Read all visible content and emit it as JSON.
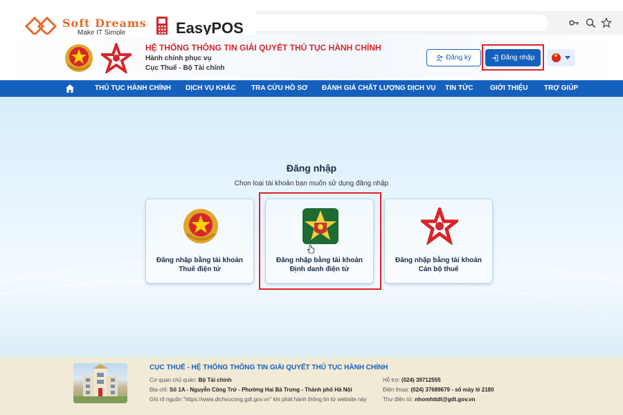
{
  "watermarks": {
    "softdreams": {
      "name": "Soft Dreams",
      "tagline": "Make IT Simple"
    },
    "easypos": {
      "name": "EasyPOS"
    }
  },
  "browser": {
    "icons": [
      "site-settings-icon",
      "key-icon",
      "zoom-icon",
      "star-icon"
    ]
  },
  "header": {
    "title": "HỆ THỐNG THÔNG TIN GIẢI QUYẾT THỦ TỤC HÀNH CHÍNH",
    "subtitle": "Hành chính phục vụ",
    "agency": "Cục Thuế - Bộ Tài chính",
    "register_label": "Đăng ký",
    "login_label": "Đăng nhập"
  },
  "nav": {
    "items": [
      {
        "label": "THỦ TỤC HÀNH CHÍNH"
      },
      {
        "label": "DỊCH VỤ KHÁC"
      },
      {
        "label": "TRA CỨU HỒ SƠ"
      },
      {
        "label": "ĐÁNH GIÁ CHẤT LƯỢNG DỊCH VỤ"
      },
      {
        "label": "TIN TỨC"
      },
      {
        "label": "GIỚI THIỆU"
      },
      {
        "label": "TRỢ GIÚP"
      }
    ]
  },
  "login": {
    "heading": "Đăng nhập",
    "subheading": "Chọn loại tài khoản bạn muốn sử dụng đăng nhập",
    "options": [
      {
        "line1": "Đăng nhập bằng tài khoản",
        "line2": "Thuế điện tử",
        "icon": "national-emblem-icon"
      },
      {
        "line1": "Đăng nhập bằng tài khoản",
        "line2": "Định danh điện tử",
        "icon": "vneid-icon"
      },
      {
        "line1": "Đăng nhập bằng tài khoản",
        "line2": "Cán bộ thuế",
        "icon": "tax-officer-logo-icon"
      }
    ]
  },
  "footer": {
    "title": "CỤC THUẾ - HỆ THỐNG THÔNG TIN GIẢI QUYẾT THỦ TỤC HÀNH CHÍNH",
    "agency_label": "Cơ quan chủ quản:",
    "agency_value": "Bộ Tài chính",
    "address_label": "Địa chỉ:",
    "address_value": "Số 1A - Nguyễn Công Trứ - Phường Hai Bà Trưng - Thành phố Hà Nội",
    "source_note": "Ghi rõ nguồn \"https://www.dichvucong.gdt.gov.vn\" khi phát hành thông tin từ website này",
    "support_label": "Hỗ trợ:",
    "support_value": "(024) 39712555",
    "phone_label": "Điện thoại:",
    "phone_value": "(024) 37689679 - số máy lẻ 2180",
    "email_label": "Thư điện tử:",
    "email_value": "nhomhttdt@gdt.gov.vn"
  },
  "colors": {
    "primary_blue": "#1560bd",
    "title_red": "#d6262b",
    "highlight_red": "#e41e25",
    "footer_bg": "#f1ead6"
  }
}
